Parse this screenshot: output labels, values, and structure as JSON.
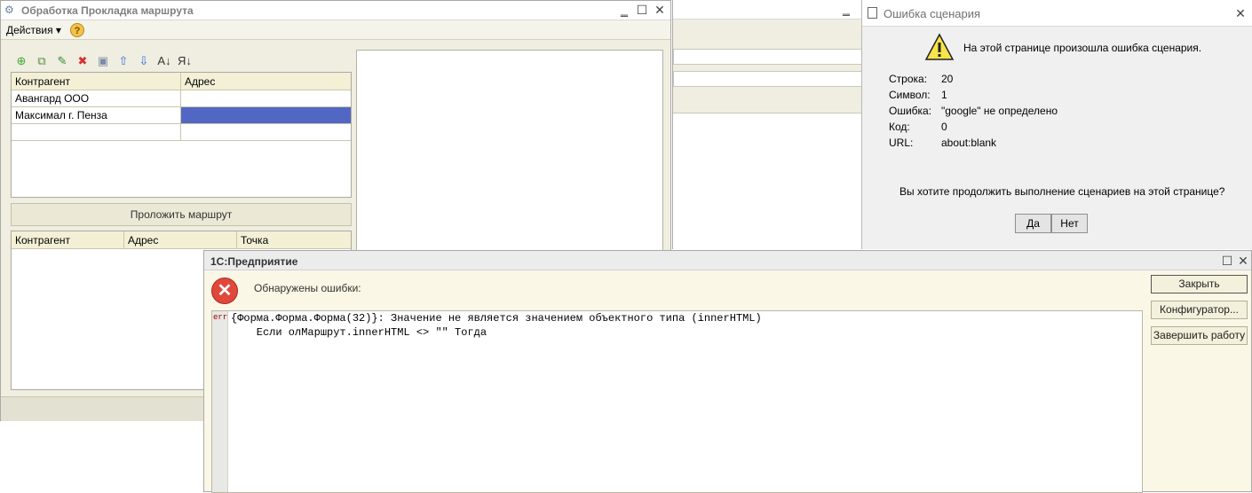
{
  "main_window": {
    "title": "Обработка  Прокладка маршрута",
    "menu_actions": "Действия ▾",
    "help": "?",
    "toolbar": [
      {
        "name": "add-icon",
        "glyph": "⊕",
        "color": "#3aa832"
      },
      {
        "name": "copy-icon",
        "glyph": "⧉",
        "color": "#5b8d3f"
      },
      {
        "name": "edit-icon",
        "glyph": "✎",
        "color": "#3a8d32"
      },
      {
        "name": "delete-icon",
        "glyph": "✖",
        "color": "#d32f2f"
      },
      {
        "name": "save-icon",
        "glyph": "▣",
        "color": "#7a8aa8"
      },
      {
        "name": "move-up-icon",
        "glyph": "⇧",
        "color": "#2f6fd3"
      },
      {
        "name": "move-down-icon",
        "glyph": "⇩",
        "color": "#2f6fd3"
      },
      {
        "name": "sort-asc-icon",
        "glyph": "A↓",
        "color": "#333333"
      },
      {
        "name": "sort-desc-icon",
        "glyph": "Я↓",
        "color": "#333333"
      }
    ],
    "table1": {
      "headers": [
        "Контрагент",
        "Адрес"
      ],
      "rows": [
        [
          "Авангард ООО",
          ""
        ],
        [
          "Максимал г. Пенза",
          ""
        ],
        [
          "",
          ""
        ]
      ]
    },
    "build_route_button": "Проложить маршрут",
    "table2": {
      "headers": [
        "Контрагент",
        "Адрес",
        "Точка"
      ]
    }
  },
  "script_error": {
    "title": "Ошибка сценария",
    "message": "На этой странице произошла ошибка сценария.",
    "details": [
      {
        "label": "Строка:",
        "value": "20"
      },
      {
        "label": "Символ:",
        "value": "1"
      },
      {
        "label": "Ошибка:",
        "value": "\"google\" не определено"
      },
      {
        "label": "Код:",
        "value": "0"
      },
      {
        "label": "URL:",
        "value": "about:blank"
      }
    ],
    "question": "Вы хотите продолжить выполнение сценариев на этой странице?",
    "yes": "Да",
    "no": "Нет"
  },
  "error_window": {
    "title": "1С:Предприятие",
    "label": "Обнаружены ошибки:",
    "err_tag": "err",
    "lines": [
      "{Форма.Форма.Форма(32)}: Значение не является значением объектного типа (innerHTML)",
      "    Если олМаршрут.innerHTML <> \"\" Тогда"
    ],
    "buttons": {
      "close": "Закрыть",
      "configurator": "Конфигуратор...",
      "exit": "Завершить работу"
    }
  }
}
